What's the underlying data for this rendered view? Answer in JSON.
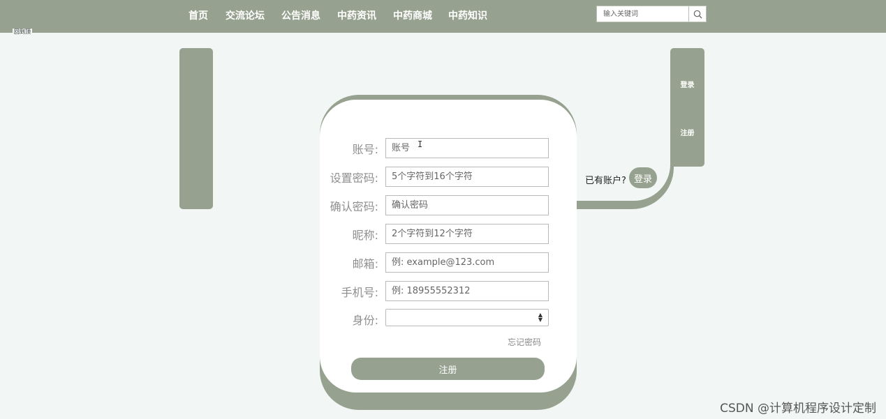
{
  "nav": {
    "items": [
      "首页",
      "交流论坛",
      "公告消息",
      "中药资讯",
      "中药商城",
      "中药知识"
    ],
    "search_placeholder": "输入关键词",
    "tiny_label": "回到顶"
  },
  "sidebar_right": {
    "login_label": "登录",
    "register_label": "注册"
  },
  "switch_tab": {
    "prompt": "已有账户?",
    "login_label": "登录"
  },
  "form": {
    "account_label": "账号:",
    "account_placeholder": "账号",
    "password_label": "设置密码:",
    "password_placeholder": "5个字符到16个字符",
    "confirm_label": "确认密码:",
    "confirm_placeholder": "确认密码",
    "nickname_label": "昵称:",
    "nickname_placeholder": "2个字符到12个字符",
    "email_label": "邮箱:",
    "email_placeholder": "例: example@123.com",
    "phone_label": "手机号:",
    "phone_placeholder": "例: 18955552312",
    "identity_label": "身份:",
    "identity_value": "",
    "forgot_label": "忘记密码",
    "submit_label": "注册"
  },
  "watermark": "CSDN @计算机程序设计定制",
  "colors": {
    "accent": "#96a28f",
    "background": "#f2f7f6",
    "card": "#ffffff"
  }
}
